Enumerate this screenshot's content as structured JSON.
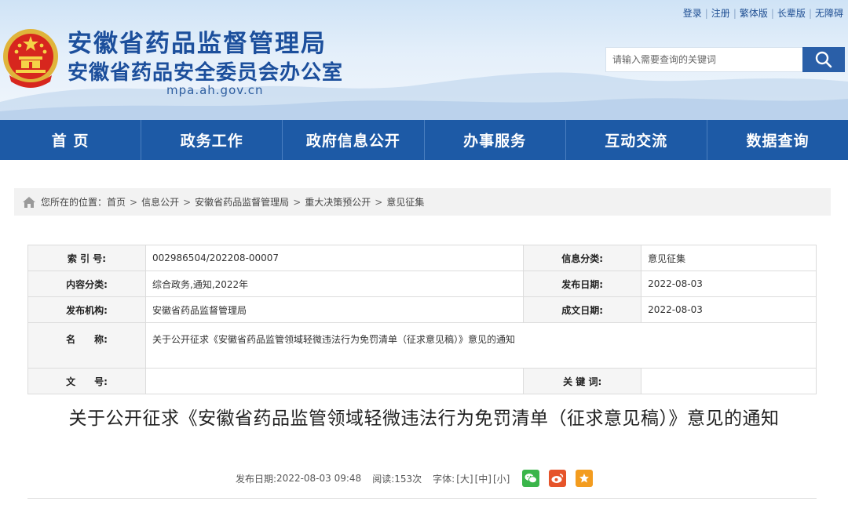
{
  "header": {
    "title_1": "安徽省药品监督管理局",
    "title_2": "安徽省药品安全委员会办公室",
    "domain": "mpa.ah.gov.cn",
    "top_links": [
      "登录",
      "注册",
      "繁体版",
      "长辈版",
      "无障碍"
    ],
    "search_placeholder": "请输入需要查询的关键词"
  },
  "nav": {
    "items": [
      "首 页",
      "政务工作",
      "政府信息公开",
      "办事服务",
      "互动交流",
      "数据查询"
    ]
  },
  "breadcrumb": {
    "prefix": "您所在的位置：",
    "items": [
      "首页",
      "信息公开",
      "安徽省药品监督管理局",
      "重大决策预公开",
      "意见征集"
    ],
    "arrow": ">"
  },
  "meta": {
    "index_label": "索 引 号:",
    "index_value": "002986504/202208-00007",
    "category_label": "信息分类:",
    "category_value": "意见征集",
    "content_label": "内容分类:",
    "content_value": "综合政务,通知,2022年",
    "publish_label": "发布日期:",
    "publish_value": "2022-08-03",
    "org_label": "发布机构:",
    "org_value": "安徽省药品监督管理局",
    "date_label": "成文日期:",
    "date_value": "2022-08-03",
    "name_label": "名　　称:",
    "name_value": "关于公开征求《安徽省药品监管领域轻微违法行为免罚清单（征求意见稿）》意见的通知",
    "doc_label": "文　　号:",
    "doc_value": "",
    "keyword_label": "关 键 词:",
    "keyword_value": ""
  },
  "article": {
    "title": "关于公开征求《安徽省药品监管领域轻微违法行为免罚清单（征求意见稿）》意见的通知",
    "date_label": "发布日期:",
    "date_value": "2022-08-03 09:48",
    "reads_label": "阅读:",
    "reads_value": "153次",
    "font_label": "字体:",
    "font_large": "[大]",
    "font_medium": "[中]",
    "font_small": "[小]"
  },
  "colors": {
    "nav_bg": "#1d5aa6",
    "title_blue": "#1c4f9c",
    "wechat": "#3ab54a",
    "weibo": "#e6542a",
    "favorite": "#f39c1f"
  },
  "icons": [
    "national-emblem-icon",
    "search-icon",
    "home-icon",
    "wechat-icon",
    "weibo-icon",
    "star-icon"
  ]
}
